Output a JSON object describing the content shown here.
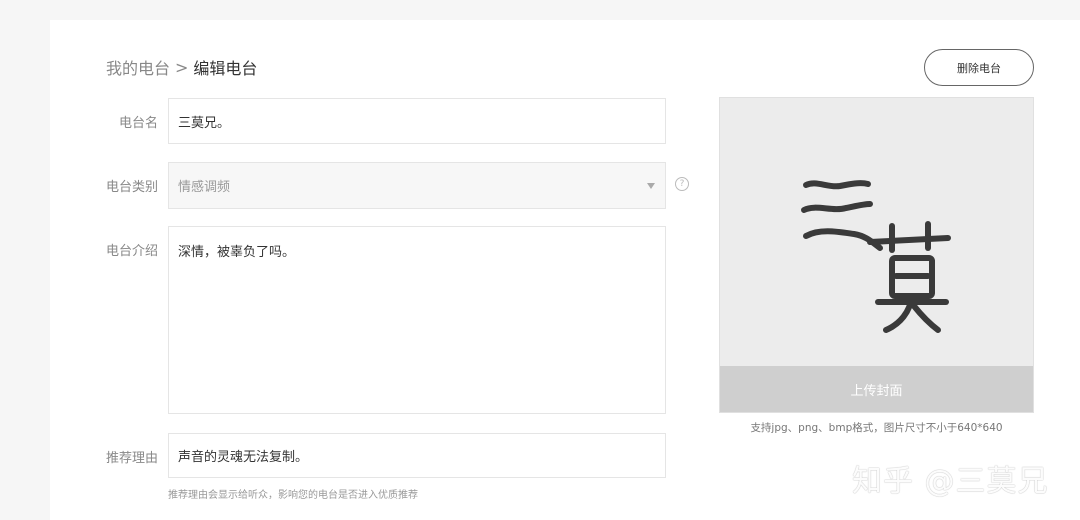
{
  "breadcrumb": {
    "parent": "我的电台",
    "separator": ">",
    "current": "编辑电台"
  },
  "delete_button": "删除电台",
  "form": {
    "name_label": "电台名",
    "name_value": "三莫兄。",
    "category_label": "电台类别",
    "category_value": "情感调频",
    "intro_label": "电台介绍",
    "intro_value": "深情，被辜负了吗。",
    "reason_label": "推荐理由",
    "reason_value": "声音的灵魂无法复制。",
    "reason_hint": "推荐理由会显示给听众，影响您的电台是否进入优质推荐"
  },
  "help_icon_glyph": "?",
  "cover": {
    "artwork_text": "三莫",
    "upload_label": "上传封面",
    "hint": "支持jpg、png、bmp格式，图片尺寸不小于640*640"
  },
  "watermark": "知乎 @三莫兄",
  "colors": {
    "background": "#f6f6f6",
    "panel": "#ffffff",
    "cover_bg": "#ececec",
    "upload_bar": "#cfcfcf"
  }
}
